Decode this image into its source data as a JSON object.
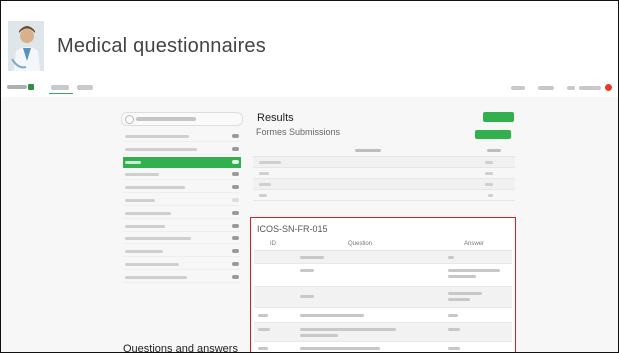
{
  "header": {
    "title": "Medical questionnaires",
    "avatar_icon": "doctor-avatar-icon"
  },
  "colors": {
    "accent": "#33b04e",
    "highlight_border": "#d62020",
    "alert": "#e23b2e"
  },
  "sidebar": {
    "qa_label": "Questions and answers"
  },
  "results": {
    "title": "Results",
    "subtitle": "Formes Submissions"
  },
  "question_table": {
    "code": "ICOS-SN-FR-015",
    "col_id": "ID",
    "col_question": "Question",
    "col_answer": "Answer"
  }
}
